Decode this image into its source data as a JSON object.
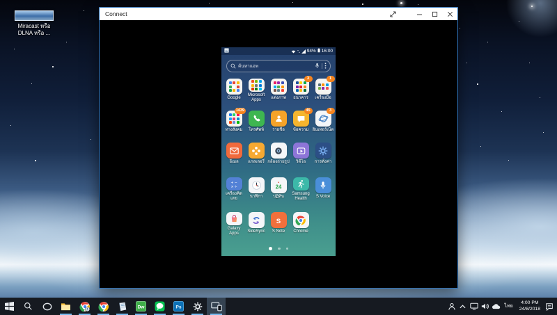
{
  "desktop": {
    "shortcut": {
      "line1": "Miracast หรือ",
      "line2": "DLNA หรือ ..."
    }
  },
  "window": {
    "title": "Connect",
    "controls": [
      "expand-icon",
      "minimize-icon",
      "maximize-icon",
      "close-icon"
    ]
  },
  "phone": {
    "status": {
      "battery_percent": "94%",
      "time": "16:00",
      "left_icon": "screenshot-icon",
      "right_icons": [
        "wifi-icon",
        "updown-icon",
        "signal-icon"
      ]
    },
    "search": {
      "placeholder": "ค้นหาแอพ",
      "icons": [
        "magnifier-icon",
        "mic-icon",
        "menu-dots-icon"
      ]
    },
    "badge_color": "#f5841f",
    "grid": [
      [
        {
          "label": "Google",
          "type": "folder",
          "dots": [
            "#4285f4",
            "#ea4335",
            "#fbbc05",
            "#34a853",
            "#ffffff",
            "#db4437",
            "#0f9d58",
            "#f4b400",
            "#4285f4"
          ]
        },
        {
          "label": "Microsoft Apps",
          "type": "folder",
          "dots": [
            "#f25022",
            "#7fba00",
            "#00a4ef",
            "#ffb900",
            "#737373",
            "#0078d7",
            "#d83b01",
            "#107c10",
            "#00bcf2"
          ]
        },
        {
          "label": "แต่งภาพ",
          "type": "folder",
          "dots": [
            "#e91e63",
            "#9c27b0",
            "#3f51b5",
            "#03a9f4",
            "#4caf50",
            "#ff9800",
            "#795548",
            "#607d8b",
            "#f44336"
          ]
        },
        {
          "label": "ธนาคาร",
          "type": "folder",
          "badge": "3",
          "dots": [
            "#1a4f9c",
            "#ffd400",
            "#00a651",
            "#7b1fa2",
            "#e31837",
            "#f6821f",
            "#0066b3",
            "#fdb913",
            "#006f3c"
          ]
        },
        {
          "label": "เครื่องมือ",
          "type": "folder",
          "badge": "1",
          "dots": [
            "#546e7a",
            "#ff8f00",
            "#039be5",
            "#7cb342",
            "#8e24aa",
            "#ef5350"
          ]
        }
      ],
      [
        {
          "label": "ทางสังคม",
          "type": "folder",
          "badge": "1439",
          "dots": [
            "#1877f2",
            "#25d366",
            "#ff0050",
            "#1da1f2",
            "#e1306c",
            "#0088cc",
            "#ff4500",
            "#7289da",
            "#00b900"
          ]
        },
        {
          "label": "โทรศัพท์",
          "icon": "phone-icon",
          "bg": "#3eb650"
        },
        {
          "label": "รายชื่อ",
          "icon": "contacts-icon",
          "bg": "#f5a329"
        },
        {
          "label": "ข้อความ",
          "icon": "messages-icon",
          "bg": "#f5b52e",
          "badge": "45"
        },
        {
          "label": "อินเทอร์เน็ต",
          "icon": "internet-icon",
          "bg": "#f4f6f8",
          "badge": "3"
        }
      ],
      [
        {
          "label": "อีเมล",
          "icon": "email-icon",
          "bg": "#f06a3c"
        },
        {
          "label": "แกลเลอรี่",
          "icon": "gallery-icon",
          "bg": "#f7a931"
        },
        {
          "label": "กล้องถ่ายรูป",
          "icon": "camera-icon",
          "bg": "#f4f6f8"
        },
        {
          "label": "วิดีโอ",
          "icon": "video-icon",
          "bg": "#8d75d8"
        },
        {
          "label": "การตั้งค่า",
          "icon": "settings-gear-icon",
          "bg": "#2c4f86"
        }
      ],
      [
        {
          "label": "เครื่องคิดเลข",
          "icon": "calculator-icon",
          "bg": "#5381d6"
        },
        {
          "label": "นาฬิกา",
          "icon": "clock-icon",
          "bg": "#f4f6f8"
        },
        {
          "label": "ปฏิทิน",
          "icon": "calendar-icon",
          "bg": "#f4f6f8"
        },
        {
          "label": "Samsung Health",
          "icon": "health-icon",
          "bg": "#3cb9a9"
        },
        {
          "label": "S Voice",
          "icon": "svoice-mic-icon",
          "bg": "#4a8fd9"
        }
      ],
      [
        {
          "label": "Galaxy Apps",
          "icon": "galaxy-apps-icon",
          "bg": "#f4f6f8"
        },
        {
          "label": "SideSync",
          "icon": "sidesync-icon",
          "bg": "#f4f6f8"
        },
        {
          "label": "S Note",
          "icon": "snote-icon",
          "bg": "#f1703c"
        },
        {
          "label": "Chrome",
          "icon": "chrome-icon",
          "bg": "#f4f6f8"
        }
      ]
    ],
    "page_dots": {
      "count": 3,
      "active": 0
    }
  },
  "taskbar": {
    "items": [
      {
        "name": "start-button",
        "icon": "windows-logo-icon"
      },
      {
        "name": "taskbar-search",
        "icon": "search-icon"
      },
      {
        "name": "task-view",
        "icon": "task-view-icon"
      },
      {
        "name": "file-explorer",
        "icon": "file-explorer-icon",
        "open": true
      },
      {
        "name": "chrome-profile",
        "icon": "chrome-profile-icon",
        "open": true
      },
      {
        "name": "chrome",
        "icon": "chrome-icon-tb",
        "open": true
      },
      {
        "name": "notepad",
        "icon": "notepad-icon",
        "open": true
      },
      {
        "name": "dreamweaver",
        "icon": "dreamweaver-icon",
        "open": true,
        "glyph_text": "Dw"
      },
      {
        "name": "line-app",
        "icon": "line-icon",
        "open": true
      },
      {
        "name": "photoshop",
        "icon": "photoshop-icon",
        "open": true,
        "glyph_text": "Ps"
      },
      {
        "name": "windows-settings",
        "icon": "gear-icon",
        "open": true
      },
      {
        "name": "connect-app",
        "icon": "connect-icon",
        "open": true,
        "active": true
      }
    ],
    "tray": {
      "icons": [
        "people-icon",
        "chevron-up-icon",
        "display-icon",
        "volume-icon",
        "onedrive-icon"
      ],
      "language": "ไทย",
      "time": "4:00 PM",
      "date": "24/8/2018",
      "action": "action-center-icon"
    }
  }
}
